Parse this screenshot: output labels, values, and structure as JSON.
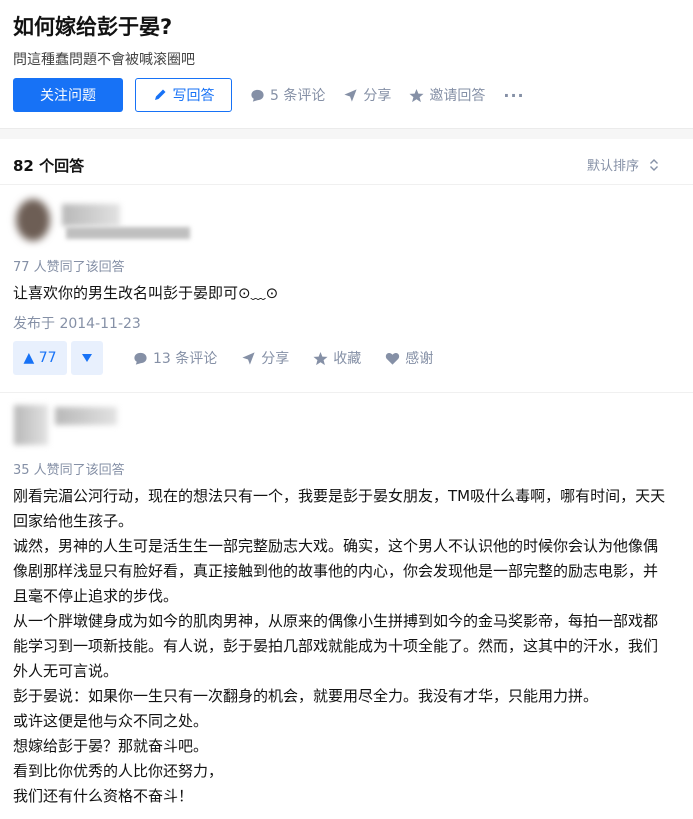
{
  "question": {
    "title": "如何嫁给彭于晏?",
    "detail": "問這種蠢問題不會被喊滚圈吧",
    "follow_label": "关注问题",
    "answer_label": "写回答",
    "comments_label": "5 条评论",
    "share_label": "分享",
    "invite_label": "邀请回答",
    "more_label": "···"
  },
  "answers_header": {
    "count_label": "82 个回答",
    "sort_label": "默认排序"
  },
  "answers": [
    {
      "votes_label": "77 人赞同了该回答",
      "paragraphs": [
        "让喜欢你的男生改名叫彭于晏即可⊙﹏⊙"
      ],
      "date": "发布于 2014-11-23",
      "upvote_label": "▲ 77",
      "comments_label": "13 条评论",
      "share_label": "分享",
      "favorite_label": "收藏",
      "thanks_label": "感谢"
    },
    {
      "votes_label": "35 人赞同了该回答",
      "paragraphs": [
        "刚看完湄公河行动，现在的想法只有一个，我要是彭于晏女朋友，TM吸什么毒啊，哪有时间，天天",
        "回家给他生孩子。",
        "诚然，男神的人生可是活生生一部完整励志大戏。确实，这个男人不认识他的时候你会认为他像偶",
        "像剧那样浅显只有脸好看，真正接触到他的故事他的内心，你会发现他是一部完整的励志电影，并",
        "且毫不停止追求的步伐。",
        "从一个胖墩健身成为如今的肌肉男神，从原来的偶像小生拼搏到如今的金马奖影帝，每拍一部戏都",
        "能学习到一项新技能。有人说，彭于晏拍几部戏就能成为十项全能了。然而，这其中的汗水，我们",
        "外人无可言说。",
        "彭于晏说：如果你一生只有一次翻身的机会，就要用尽全力。我没有才华，只能用力拼。",
        "或许这便是他与众不同之处。",
        "想嫁给彭于晏？那就奋斗吧。",
        "看到比你优秀的人比你还努力，",
        "我们还有什么资格不奋斗！"
      ]
    }
  ],
  "colors": {
    "brand": "#1772f6",
    "meta": "#8590a6"
  }
}
